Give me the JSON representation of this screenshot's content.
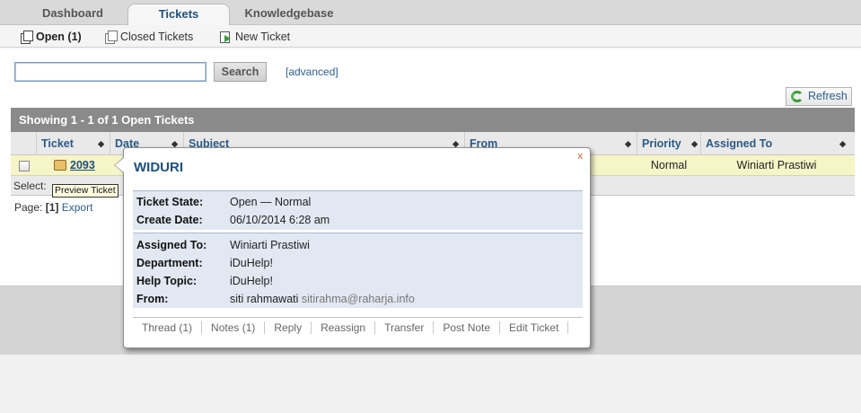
{
  "tabs": [
    {
      "label": "Dashboard"
    },
    {
      "label": "Tickets",
      "active": true
    },
    {
      "label": "Knowledgebase"
    }
  ],
  "subnav": [
    {
      "label": "Open (1)",
      "icon": "open-tickets-icon"
    },
    {
      "label": "Closed Tickets",
      "icon": "closed-tickets-icon"
    },
    {
      "label": "New Ticket",
      "icon": "new-ticket-icon"
    }
  ],
  "search": {
    "value": "",
    "placeholder": "",
    "button": "Search",
    "advanced": "[advanced]"
  },
  "refresh": {
    "label": "Refresh",
    "icon": "refresh-icon"
  },
  "table": {
    "showing": "Showing  1 - 1 of 1   Open Tickets",
    "headers": {
      "ticket": "Ticket",
      "date": "Date",
      "subject": "Subject",
      "from": "From",
      "priority": "Priority",
      "assigned": "Assigned To"
    },
    "row": {
      "ticket": "2093",
      "priority": "Normal",
      "assigned": "Winiarti Prastiwi"
    },
    "select_label": "Select:",
    "page_label": "Page:",
    "page_current": "[1]",
    "export": "Export"
  },
  "tooltip": "Preview Ticket",
  "popup": {
    "close": "x",
    "title": "WIDURI",
    "ticket_state_label": "Ticket State:",
    "ticket_state": "Open — Normal",
    "create_date_label": "Create Date:",
    "create_date": "06/10/2014 6:28 am",
    "assigned_label": "Assigned To:",
    "assigned": "Winiarti Prastiwi",
    "department_label": "Department:",
    "department": "iDuHelp!",
    "help_topic_label": "Help Topic:",
    "help_topic": "iDuHelp!",
    "from_label": "From:",
    "from_name": "siti rahmawati",
    "from_email": "sitirahma@raharja.info",
    "actions": [
      "Thread (1)",
      "Notes (1)",
      "Reply",
      "Reassign",
      "Transfer",
      "Post Note",
      "Edit Ticket"
    ]
  },
  "colors": {
    "link_blue": "#1f4f7a",
    "row_highlight": "#f6f5c8",
    "showing_bar": "#8a8a8a"
  }
}
